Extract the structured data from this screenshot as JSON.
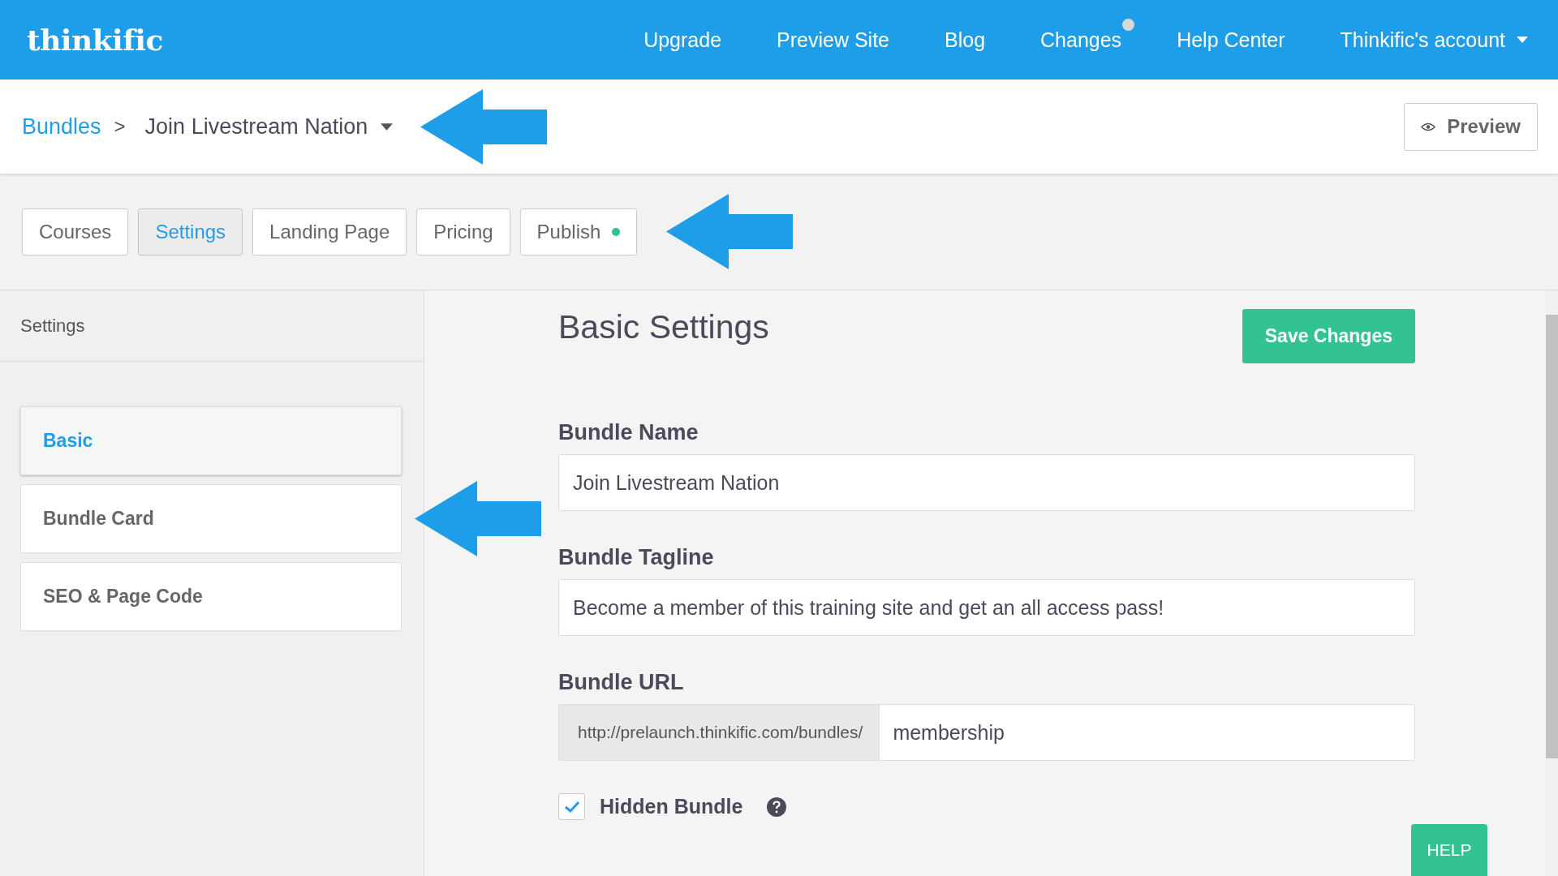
{
  "header": {
    "logo": "thinkific",
    "nav": [
      {
        "label": "Upgrade",
        "badge": false,
        "dropdown": false
      },
      {
        "label": "Preview Site",
        "badge": false,
        "dropdown": false
      },
      {
        "label": "Blog",
        "badge": false,
        "dropdown": false
      },
      {
        "label": "Changes",
        "badge": true,
        "dropdown": false
      },
      {
        "label": "Help Center",
        "badge": false,
        "dropdown": false
      },
      {
        "label": "Thinkific's account",
        "badge": false,
        "dropdown": true
      }
    ]
  },
  "breadcrumb": {
    "parent": "Bundles",
    "separator": ">",
    "current": "Join Livestream Nation",
    "preview_button": "Preview"
  },
  "tabs": [
    {
      "label": "Courses",
      "selected": false,
      "status_dot": false
    },
    {
      "label": "Settings",
      "selected": true,
      "status_dot": false
    },
    {
      "label": "Landing Page",
      "selected": false,
      "status_dot": false
    },
    {
      "label": "Pricing",
      "selected": false,
      "status_dot": false
    },
    {
      "label": "Publish",
      "selected": false,
      "status_dot": true
    }
  ],
  "sidebar": {
    "title": "Settings",
    "items": [
      {
        "label": "Basic",
        "selected": true
      },
      {
        "label": "Bundle Card",
        "selected": false
      },
      {
        "label": "SEO & Page Code",
        "selected": false
      }
    ]
  },
  "form": {
    "title": "Basic Settings",
    "save_button": "Save Changes",
    "fields": [
      {
        "label": "Bundle Name",
        "value": "Join Livestream Nation"
      },
      {
        "label": "Bundle Tagline",
        "value": "Become a member of this training site and get an all access pass!"
      }
    ],
    "url": {
      "label": "Bundle URL",
      "prefix": "http://prelaunch.thinkific.com/bundles/",
      "value": "membership"
    },
    "hidden": {
      "label": "Hidden Bundle",
      "checked": true
    }
  },
  "help_button": "HELP"
}
